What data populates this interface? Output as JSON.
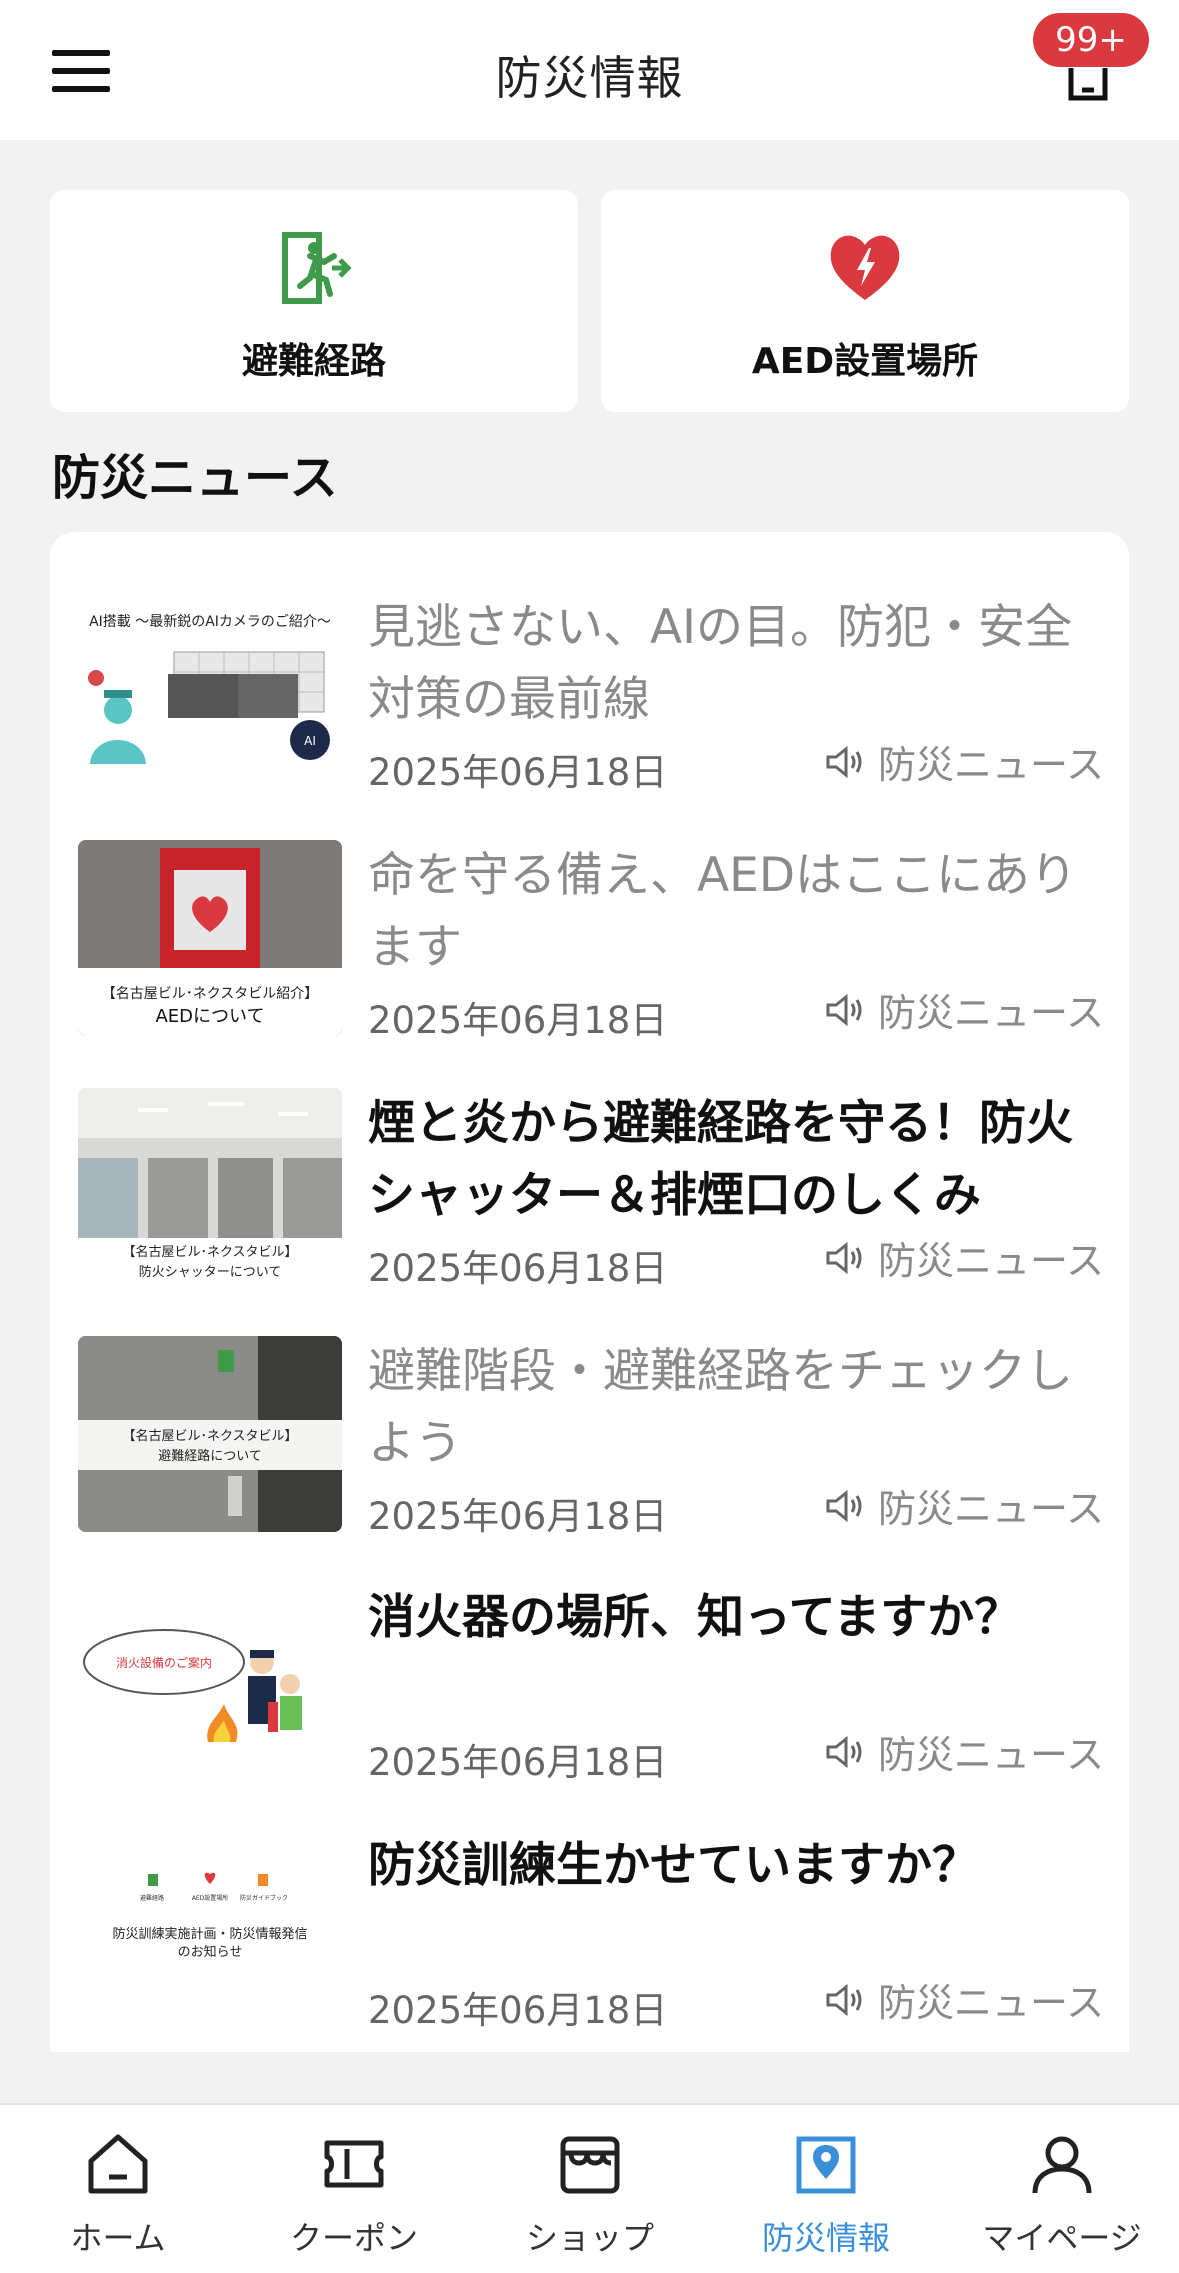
{
  "header": {
    "title": "防災情報",
    "notification_badge": "99+"
  },
  "quick_links": [
    {
      "label": "避難経路",
      "icon": "emergency-exit-icon"
    },
    {
      "label": "AED設置場所",
      "icon": "aed-heart-icon"
    }
  ],
  "news": {
    "section_title": "防災ニュース",
    "items": [
      {
        "title": "見逃さない、AIの目。防犯・安全対策の最前線",
        "date": "2025年06月18日",
        "category": "防災ニュース",
        "read": true,
        "thumb_caption": "AI搭載 〜最新鋭のAIカメラのご紹介〜"
      },
      {
        "title": "命を守る備え、AEDはここにあります",
        "date": "2025年06月18日",
        "category": "防災ニュース",
        "read": true,
        "thumb_caption": "【名古屋ビル･ネクスタビル紹介】",
        "thumb_caption2": "AEDについて"
      },
      {
        "title": "煙と炎から避難経路を守る！防火シャッター＆排煙口のしくみ",
        "date": "2025年06月18日",
        "category": "防災ニュース",
        "read": false,
        "thumb_caption": "【名古屋ビル･ネクスタビル】",
        "thumb_caption2": "防火シャッターについて"
      },
      {
        "title": "避難階段・避難経路をチェックしよう",
        "date": "2025年06月18日",
        "category": "防災ニュース",
        "read": true,
        "thumb_caption": "【名古屋ビル･ネクスタビル】",
        "thumb_caption2": "避難経路について"
      },
      {
        "title": "消火器の場所、知ってますか？",
        "date": "2025年06月18日",
        "category": "防災ニュース",
        "read": false,
        "thumb_caption": "消火設備のご案内"
      },
      {
        "title": "防災訓練生かせていますか？",
        "date": "2025年06月18日",
        "category": "防災ニュース",
        "read": false,
        "thumb_labels": [
          "避難経路",
          "AED設置場所",
          "防災ガイドブック"
        ],
        "thumb_caption": "防災訓練実施計画・防災情報発信",
        "thumb_caption2": "のお知らせ"
      }
    ]
  },
  "bottom_nav": [
    {
      "label": "ホーム",
      "icon": "home-icon",
      "active": false
    },
    {
      "label": "クーポン",
      "icon": "coupon-icon",
      "active": false
    },
    {
      "label": "ショップ",
      "icon": "shop-icon",
      "active": false
    },
    {
      "label": "防災情報",
      "icon": "disaster-map-icon",
      "active": true
    },
    {
      "label": "マイページ",
      "icon": "user-icon",
      "active": false
    }
  ],
  "colors": {
    "accent": "#3b8fd9",
    "badge": "#d9393f",
    "exit_green": "#3f9a4a",
    "aed_red": "#d9393f"
  }
}
